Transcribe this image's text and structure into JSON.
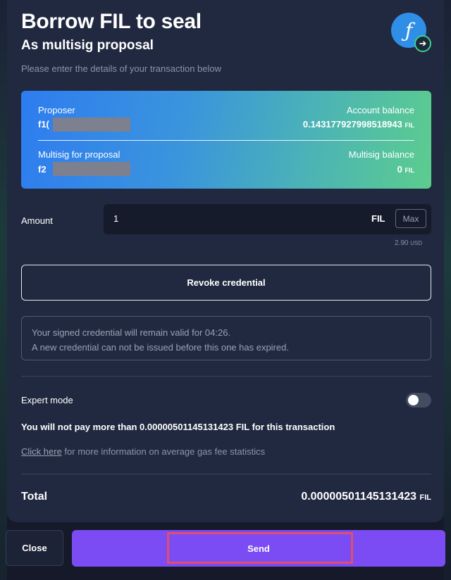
{
  "header": {
    "title": "Borrow FIL to seal",
    "subtitle": "As multisig proposal",
    "instructions": "Please enter the details of your transaction below",
    "logo_icon": "filecoin-logo-icon",
    "logo_glyph": "ƒ",
    "logo_arrow_glyph": "➜"
  },
  "balance_card": {
    "proposer_label": "Proposer",
    "proposer_value": "f1(",
    "account_balance_label": "Account balance",
    "account_balance_value": "0.14317792799851894​3",
    "account_balance_unit": "FIL",
    "multisig_label": "Multisig for proposal",
    "multisig_value": "f2",
    "multisig_balance_label": "Multisig balance",
    "multisig_balance_value": "0",
    "multisig_balance_unit": "FIL"
  },
  "amount": {
    "label": "Amount",
    "value": "1",
    "unit": "FIL",
    "max_label": "Max",
    "usd_value": "2.90",
    "usd_unit": "USD"
  },
  "revoke_label": "Revoke credential",
  "notice": {
    "line1": "Your signed credential will remain valid for 04:26.",
    "line2": "A new credential can not be issued before this one has expired."
  },
  "expert_mode": {
    "label": "Expert mode",
    "enabled": false
  },
  "limit_text": "You will not pay more than 0.00000501145131423 FIL for this transaction",
  "gas": {
    "link_text": "Click here",
    "rest_text": " for more information on average gas fee statistics"
  },
  "total": {
    "label": "Total",
    "value": "0.00000501145131423",
    "unit": "FIL"
  },
  "footer": {
    "close_label": "Close",
    "send_label": "Send"
  },
  "colors": {
    "accent": "#7b4cf4",
    "highlight": "#e04d6e",
    "card_gradient_start": "#2e7cf0",
    "card_gradient_end": "#5ccd8e"
  }
}
